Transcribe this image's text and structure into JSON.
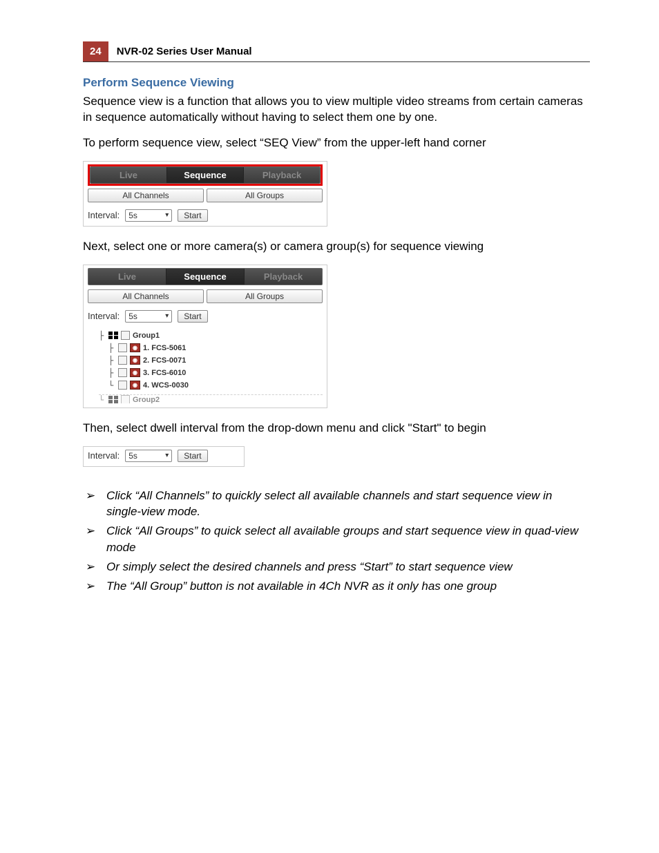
{
  "header": {
    "page_number": "24",
    "doc_title": "NVR-02 Series User Manual"
  },
  "section_title": "Perform Sequence Viewing",
  "paragraphs": {
    "intro": "Sequence view is a function that allows you to view multiple video streams from certain cameras in sequence automatically without having to select them one by one.",
    "step1": "To perform sequence view, select “SEQ View” from the upper-left hand corner",
    "step2": "Next, select one or more camera(s) or camera group(s) for sequence viewing",
    "step3": "Then, select dwell interval from the drop-down menu and click \"Start\" to begin"
  },
  "ui": {
    "tabs": {
      "live": "Live",
      "sequence": "Sequence",
      "playback": "Playback"
    },
    "buttons": {
      "all_channels": "All Channels",
      "all_groups": "All Groups",
      "start": "Start"
    },
    "interval_label": "Interval:",
    "interval_value": "5s",
    "tree": {
      "group": "Group1",
      "items": [
        "1. FCS-5061",
        "2. FCS-0071",
        "3. FCS-6010",
        "4. WCS-0030"
      ],
      "next_group_partial": "Group2"
    }
  },
  "notes": [
    "Click “All Channels” to quickly select all available channels and start sequence view in single-view mode.",
    "Click “All Groups” to quick select all available groups and start sequence view in quad-view mode",
    "Or simply select the desired channels and press “Start” to start sequence view",
    "The “All Group” button is not available in 4Ch NVR as it only has one group"
  ]
}
